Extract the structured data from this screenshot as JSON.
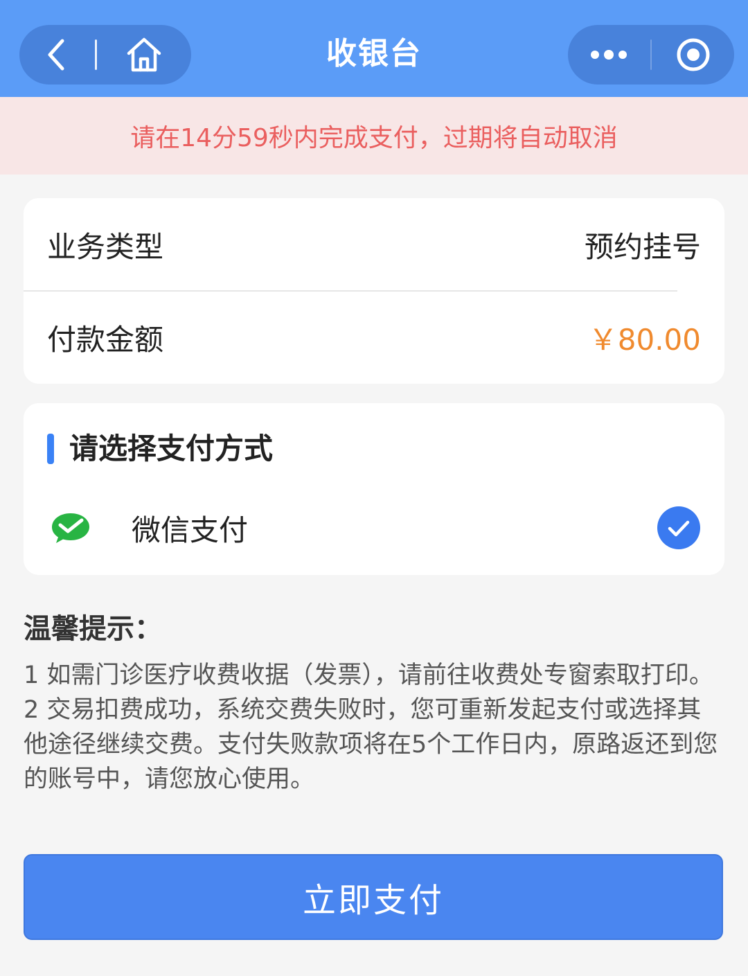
{
  "header": {
    "title": "收银台",
    "left_capsule": {
      "back_icon": "chevron-left-icon",
      "home_icon": "home-icon"
    },
    "right_capsule": {
      "more_icon": "more-dots-icon",
      "close_icon": "target-circle-icon"
    }
  },
  "banner": {
    "text": "请在14分59秒内完成支付，过期将自动取消"
  },
  "order": {
    "business_type_label": "业务类型",
    "business_type_value": "预约挂号",
    "amount_label": "付款金额",
    "amount_value": "￥80.00"
  },
  "payment": {
    "section_title": "请选择支付方式",
    "methods": [
      {
        "label": "微信支付",
        "icon": "wechat-pay-icon",
        "selected": true
      }
    ]
  },
  "tips": {
    "title": "温馨提示：",
    "items": [
      "1 如需门诊医疗收费收据（发票），请前往收费处专窗索取打印。",
      "2 交易扣费成功，系统交费失败时，您可重新发起支付或选择其他途径继续交费。支付失败款项将在5个工作日内，原路返还到您的账号中，请您放心使用。"
    ]
  },
  "pay_button": {
    "label": "立即支付"
  },
  "colors": {
    "header_bg": "#5b9cf7",
    "banner_bg": "#f8e6e6",
    "banner_text": "#ea5f5f",
    "amount": "#f08a2e",
    "accent": "#3a82f6",
    "wechat_green": "#28b443",
    "button_bg": "#4a86f0"
  }
}
